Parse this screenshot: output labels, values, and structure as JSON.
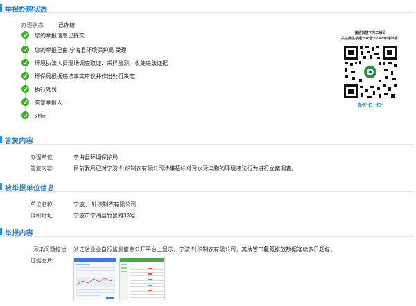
{
  "status_section": {
    "title": "举报办理状态",
    "status_label": "办理状态:",
    "status_value": "已办结",
    "steps": [
      "您的举报信息已提交",
      "您的举报已由 宁海县环境保护局 受理",
      "环境执法人员现场调查取证、采样监测、收集违法证据",
      "环保局根据违法事实审议并作出处罚决定",
      "执行处罚",
      "答复举报人",
      "办结"
    ]
  },
  "qr": {
    "caption_line1": "微信扫描下方二维码",
    "caption_line2": "关注微信举报公众号“12369环保举报”",
    "footer": "微信“扫一扫”"
  },
  "reply_section": {
    "title": "答复内容",
    "unit_label": "办理单位:",
    "unit_value": "宁海县环境保护局",
    "content_label": "答复内容:",
    "content_value": "目前我局已对宁波       针织制衣有限公司涉嫌超标排污水污染物的环境违法行为进行立案调查。"
  },
  "reported_section": {
    "title": "被举报单位信息",
    "name_label": "单位名称:",
    "name_value": "宁波、    针织制衣有限公司",
    "address_label": "详细地址:",
    "address_value": "宁波市宁海县竹景路33号"
  },
  "report_section": {
    "title": "举报内容",
    "desc_label": "污染问题描述:",
    "desc_value": "浙江省企业自行监测信息公开平台上显示，宁波      针织制衣有限公司，其纳管口氨氮排放数据连续多日超标。",
    "evidence_label": "证据图片:"
  },
  "colors": {
    "accent": "#2f8fd8",
    "check": "#3fae2a"
  }
}
